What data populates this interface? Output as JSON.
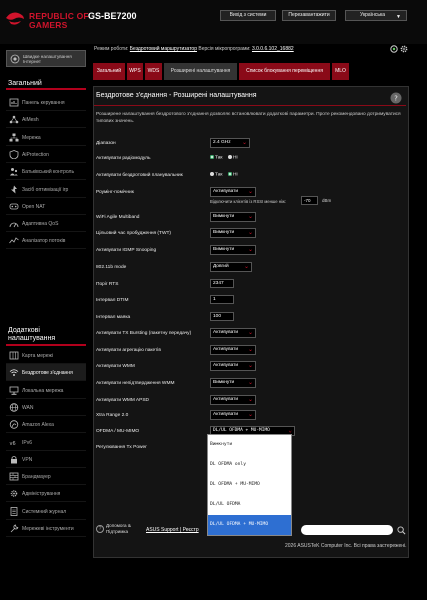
{
  "header": {
    "brand_line1": "REPUBLIC OF",
    "brand_line2": "GAMERS",
    "model": "GS-BE7200",
    "logout_label": "Вихід з системи",
    "reboot_label": "Перезавантажити",
    "language": "Українська"
  },
  "info": {
    "mode_label": "Режим роботи:",
    "mode_value": "Бездротовий маршрутизатор",
    "fw_label": "Версія мікропрограми:",
    "fw_value": "3.0.0.6.102_16882"
  },
  "sidebar": {
    "wizard_label": "Швидке налаштування Інтернет",
    "general_title": "Загальний",
    "general_items": [
      {
        "label": "Панель керування",
        "icon": "dashboard-icon"
      },
      {
        "label": "AiMesh",
        "icon": "aimesh-icon"
      },
      {
        "label": "Мережа",
        "icon": "network-icon"
      },
      {
        "label": "AiProtection",
        "icon": "shield-icon"
      },
      {
        "label": "Батьківський контроль",
        "icon": "parental-icon"
      },
      {
        "label": "Засіб оптимізації ігр",
        "icon": "game-boost-icon"
      },
      {
        "label": "Open NAT",
        "icon": "open-nat-icon"
      },
      {
        "label": "Адаптивна QoS",
        "icon": "qos-icon"
      },
      {
        "label": "Аналізатор потоків",
        "icon": "analyzer-icon"
      }
    ],
    "advanced_title": "Додаткові налаштування",
    "advanced_items": [
      {
        "label": "Карта мережі",
        "icon": "network-map-icon"
      },
      {
        "label": "Бездротове з'єднання",
        "icon": "wifi-icon"
      },
      {
        "label": "Локальна мережа",
        "icon": "lan-icon"
      },
      {
        "label": "WAN",
        "icon": "globe-icon"
      },
      {
        "label": "Amazon Alexa",
        "icon": "alexa-icon"
      },
      {
        "label": "IPv6",
        "icon": "ipv6-icon"
      },
      {
        "label": "VPN",
        "icon": "vpn-icon"
      },
      {
        "label": "Брандмауер",
        "icon": "firewall-icon"
      },
      {
        "label": "Адміністрування",
        "icon": "admin-icon"
      },
      {
        "label": "Системний журнал",
        "icon": "log-icon"
      },
      {
        "label": "Мережеві інструменти",
        "icon": "tools-icon"
      }
    ]
  },
  "tabs": [
    "Загальний",
    "WPS",
    "WDS",
    "Розширені налаштування",
    "Список блокування переміщення",
    "MLO"
  ],
  "panel": {
    "title": "Бездротове з'єднання - Розширені налаштування",
    "description": "Розширене налаштування бездротового з'єднання дозволяє встановлювати додаткові параметри. Проте рекомендовано дотримуватися типових значень.",
    "band_label": "Діапазон",
    "band_value": "2.4 GHz",
    "radio_label": "Активувати радіомодуль",
    "sched_label": "Активувати бездротовий планувальник",
    "yes": "Так",
    "no": "Ні",
    "roaming_label": "Роумінг-помічник",
    "roaming_value": "Активувати",
    "rssi_note": "Відключити клієнтів із RSSI менше ніж:",
    "rssi_value": "-70",
    "rssi_unit": "dBm",
    "multiband_label": "WiFi Agile Multiband",
    "multiband_value": "Вимкнути",
    "twt_label": "Цільовий час пробудження (TWT)",
    "twt_value": "Вимкнути",
    "igmp_label": "Активувати IGMP Snooping",
    "igmp_value": "Вимкнути",
    "b_label": "802.11b mode",
    "b_value": "Довгий",
    "rts_label": "Поріг RTS",
    "rts_value": "2347",
    "dtim_label": "Інтервал DTIM",
    "dtim_value": "1",
    "beacon_label": "Інтервал маяка",
    "beacon_value": "100",
    "txburst_label": "Активувати TX Bursting (пакетну передачу)",
    "txburst_value": "Активувати",
    "aggr_label": "Активувати агрегацію пакетів",
    "aggr_value": "Активувати",
    "wmm_label": "Активувати WMM",
    "wmm_value": "Активувати",
    "wmmnoack_label": "Активувати непідтвердження WMM",
    "wmmnoack_value": "Вимкнути",
    "apsd_label": "Активувати WMM APSD",
    "apsd_value": "Активувати",
    "xtra_label": "Xtra Range 2.0",
    "xtra_value": "Активувати",
    "ofdma_label": "OFDMA / MU-MIMO",
    "ofdma_value": "DL/UL OFDMA + MU-MIMO",
    "txpower_label": "Регулювання Tx Power",
    "ofdma_options": [
      "Вимкнути",
      "DL OFDMA only",
      "DL OFDMA + MU-MIMO",
      "DL/UL OFDMA",
      "DL/UL OFDMA + MU-MIMO"
    ]
  },
  "footer": {
    "help_label": "Допомога & Підтримка",
    "support_label": "ASUS Support",
    "support_sep": " | ",
    "support_extra": "Реєстр",
    "copyright": "2026 ASUSTeK Computer Inc. Всі права застережені."
  }
}
